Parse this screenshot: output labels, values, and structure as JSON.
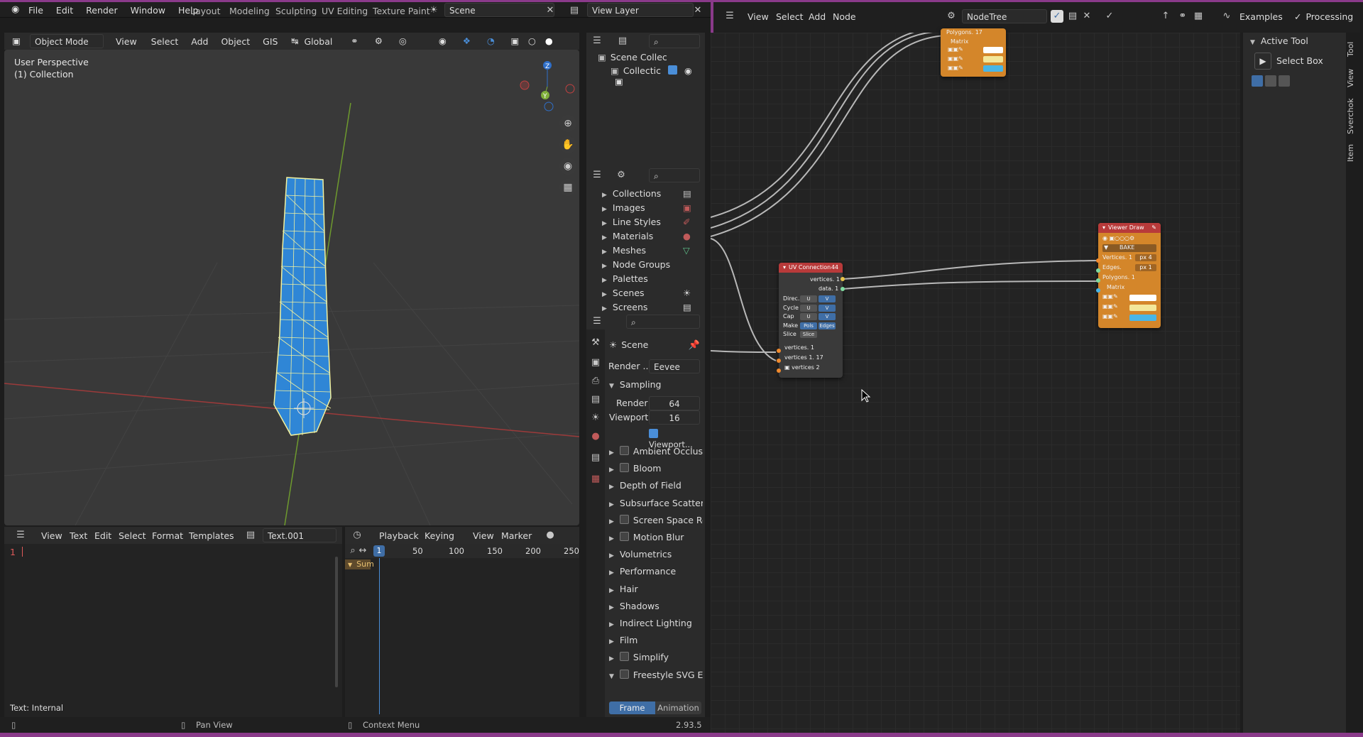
{
  "topbar": {
    "menu": [
      "File",
      "Edit",
      "Render",
      "Window",
      "Help"
    ],
    "workspaces": [
      "Layout",
      "Modeling",
      "Sculpting",
      "UV Editing",
      "Texture Paint"
    ],
    "scene": "Scene",
    "view_layer": "View Layer"
  },
  "viewport": {
    "mode": "Object Mode",
    "menus": [
      "View",
      "Select",
      "Add",
      "Object",
      "GIS"
    ],
    "orientation": "Global",
    "overlay_line1": "User Perspective",
    "overlay_line2": "(1) Collection",
    "colors": {
      "mesh": "#2f86d6",
      "wire": "#f2f2a0",
      "x_axis": "#b34848",
      "y_axis": "#7fb03a"
    }
  },
  "outliner": {
    "scene_collection": "Scene Collec",
    "collection": "Collectic"
  },
  "data_api": {
    "items": [
      "Collections",
      "Images",
      "Line Styles",
      "Materials",
      "Meshes",
      "Node Groups",
      "Palettes",
      "Scenes",
      "Screens"
    ]
  },
  "properties": {
    "scene_label": "Scene",
    "render_engine_label": "Render ...",
    "render_engine": "Eevee",
    "sampling": "Sampling",
    "render_label": "Render",
    "render_value": "64",
    "viewport_label": "Viewport",
    "viewport_value": "16",
    "viewport_denoise": "Viewport...",
    "sections": [
      {
        "label": "Ambient Occlusion",
        "checkbox": true
      },
      {
        "label": "Bloom",
        "checkbox": true
      },
      {
        "label": "Depth of Field",
        "checkbox": false
      },
      {
        "label": "Subsurface Scattering",
        "checkbox": false
      },
      {
        "label": "Screen Space Refl...",
        "checkbox": true
      },
      {
        "label": "Motion Blur",
        "checkbox": true
      },
      {
        "label": "Volumetrics",
        "checkbox": false
      },
      {
        "label": "Performance",
        "checkbox": false
      },
      {
        "label": "Hair",
        "checkbox": false
      },
      {
        "label": "Shadows",
        "checkbox": false
      },
      {
        "label": "Indirect Lighting",
        "checkbox": false
      },
      {
        "label": "Film",
        "checkbox": false
      },
      {
        "label": "Simplify",
        "checkbox": true
      },
      {
        "label": "Freestyle SVG Expo...",
        "checkbox": true
      }
    ],
    "frame_tab": "Frame",
    "animation_tab": "Animation"
  },
  "text_editor": {
    "menus": [
      "View",
      "Text",
      "Edit",
      "Select",
      "Format",
      "Templates"
    ],
    "text_name": "Text.001",
    "line_number": "1",
    "footer": "Text: Internal"
  },
  "timeline": {
    "menus": [
      "Playback",
      "Keying",
      "View",
      "Marker"
    ],
    "ticks": [
      "1",
      "50",
      "100",
      "150",
      "200",
      "250"
    ],
    "summary": "Sum"
  },
  "status_bar": {
    "pan": "Pan View",
    "context": "Context Menu",
    "version": "2.93.5"
  },
  "node_editor": {
    "menus": [
      "View",
      "Select",
      "Add",
      "Node"
    ],
    "tree_name": "NodeTree",
    "examples": "Examples",
    "processing": "Processing",
    "top_node": {
      "polygons": "Polygons. 17",
      "matrix": "Matrix"
    },
    "uv_node": {
      "title": "UV Connection",
      "badge": "44",
      "out1": "vertices. 1",
      "out2": "data. 1",
      "rows": [
        {
          "label": "Direc..",
          "a": "U",
          "b": "V"
        },
        {
          "label": "Cycle",
          "a": "U",
          "b": "V"
        },
        {
          "label": "Cap",
          "a": "U",
          "b": "V"
        },
        {
          "label": "Make",
          "a": "Pols",
          "b": "Edges"
        },
        {
          "label": "Slice",
          "a": "Slice",
          "b": ""
        }
      ],
      "in1": "vertices. 1",
      "in2": "vertices 1. 17",
      "in3": "vertices 2"
    },
    "viewer_node": {
      "title": "Viewer Draw",
      "bake": "BAKE",
      "vertices": "Vertices. 1",
      "vertices_px": "px 4",
      "edges": "Edges.",
      "edges_px": "px 1",
      "polygons": "Polygons. 1",
      "matrix": "Matrix"
    },
    "colors": {
      "node_orange": "#d4862a",
      "node_red_header": "#b83a3a",
      "wire": "#b8b8b8"
    }
  },
  "sidebar": {
    "header": "Active Tool",
    "tool": "Select Box",
    "tabs": [
      "Tool",
      "View",
      "Sverchok",
      "Item"
    ]
  }
}
